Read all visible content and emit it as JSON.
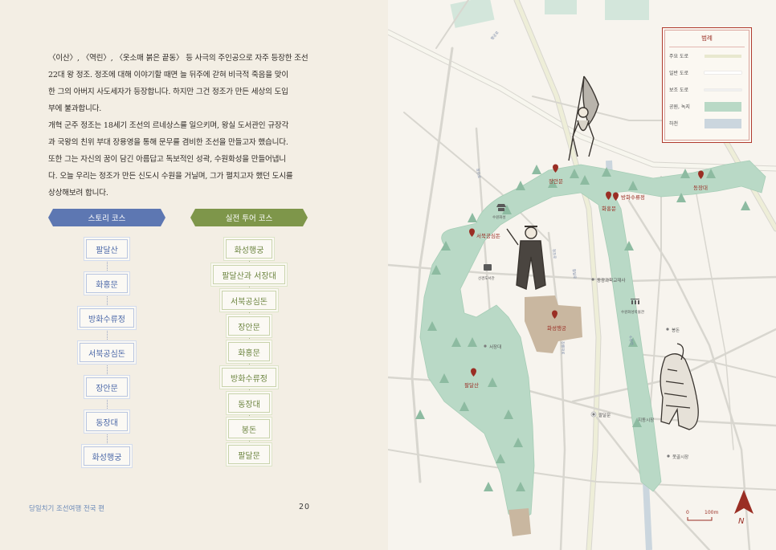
{
  "intro": {
    "paragraph1": "〈이산〉, 〈역린〉, 〈옷소매 붉은 끝동〉 등 사극의 주인공으로 자주 등장한 조선\n22대 왕 정조. 정조에 대해 이야기할 때면 늘 뒤주에 갇혀 비극적 죽음을 맞이\n한 그의 아버지 사도세자가 등장합니다. 하지만 그건 정조가 만든 세상의 도입\n부에 불과합니다.",
    "paragraph2": "개혁 군주 정조는 18세기 조선의 르네상스를 일으키며, 왕실 도서관인 규장각\n과 국왕의 친위 부대 장용영을 통해 문무를 겸비한 조선을 만들고자 했습니다.\n또한 그는 자신의 꿈이 담긴 아름답고 독보적인 성곽, 수원화성을 만들어냅니\n다. 오늘 우리는 정조가 만든 신도시 수원을 거닐며, 그가 펼치고자 했던 도시를\n상상해보려 합니다."
  },
  "story_course": {
    "title": "스토리 코스",
    "stops": [
      "팔달산",
      "화홍문",
      "방화수류정",
      "서북공심돈",
      "장안문",
      "동장대",
      "화성행궁"
    ]
  },
  "tour_course": {
    "title": "실전 투어 코스",
    "stops": [
      "화성행궁",
      "팔달산과 서장대",
      "서북공심돈",
      "장안문",
      "화홍문",
      "방화수류정",
      "동장대",
      "봉돈",
      "팔달문"
    ]
  },
  "footer": {
    "book_title": "당일치기 조선여행 전국 편",
    "page_number": "20"
  },
  "legend": {
    "title": "범례",
    "rows": [
      {
        "label": "주요 도로",
        "color": "#e8e8cf"
      },
      {
        "label": "일반 도로",
        "color": "#ffffff"
      },
      {
        "label": "보조 도로",
        "color": "#f0f0f0"
      },
      {
        "label": "공원, 녹지",
        "color": "#b9d9c6"
      },
      {
        "label": "하천",
        "color": "#cbd6de"
      }
    ]
  },
  "map_labels": {
    "janganmun": "장안문",
    "banghwa": "방화수류정",
    "hwahongmun": "화홍문",
    "dongjangdae": "동장대",
    "seobuk": "서북공심돈",
    "hwaseonghaenggung": "화성행궁",
    "paldalsan": "팔달산",
    "seojangdae": "서장대",
    "paldalmun": "팔달문",
    "bongdon": "봉돈",
    "motgol": "못골시장",
    "jidong": "지동시장",
    "donggwang": "동광과학교재사",
    "museum": "수원화성박물관",
    "library": "선경도서관",
    "suwonhwaseong": "수원화성",
    "road1": "장안로",
    "road2": "정조로",
    "road3": "팔달로",
    "road4": "창룡대로",
    "road5": "행궁로",
    "river": "수원천"
  },
  "scale": {
    "zero": "0",
    "distance": "100m"
  },
  "compass": {
    "letter": "N"
  },
  "colors": {
    "story_blue": "#5d77b2",
    "tour_green": "#7e964a",
    "park": "#b9d9c6",
    "pin_red": "#9a2e24",
    "palace": "#c9b7a0"
  }
}
